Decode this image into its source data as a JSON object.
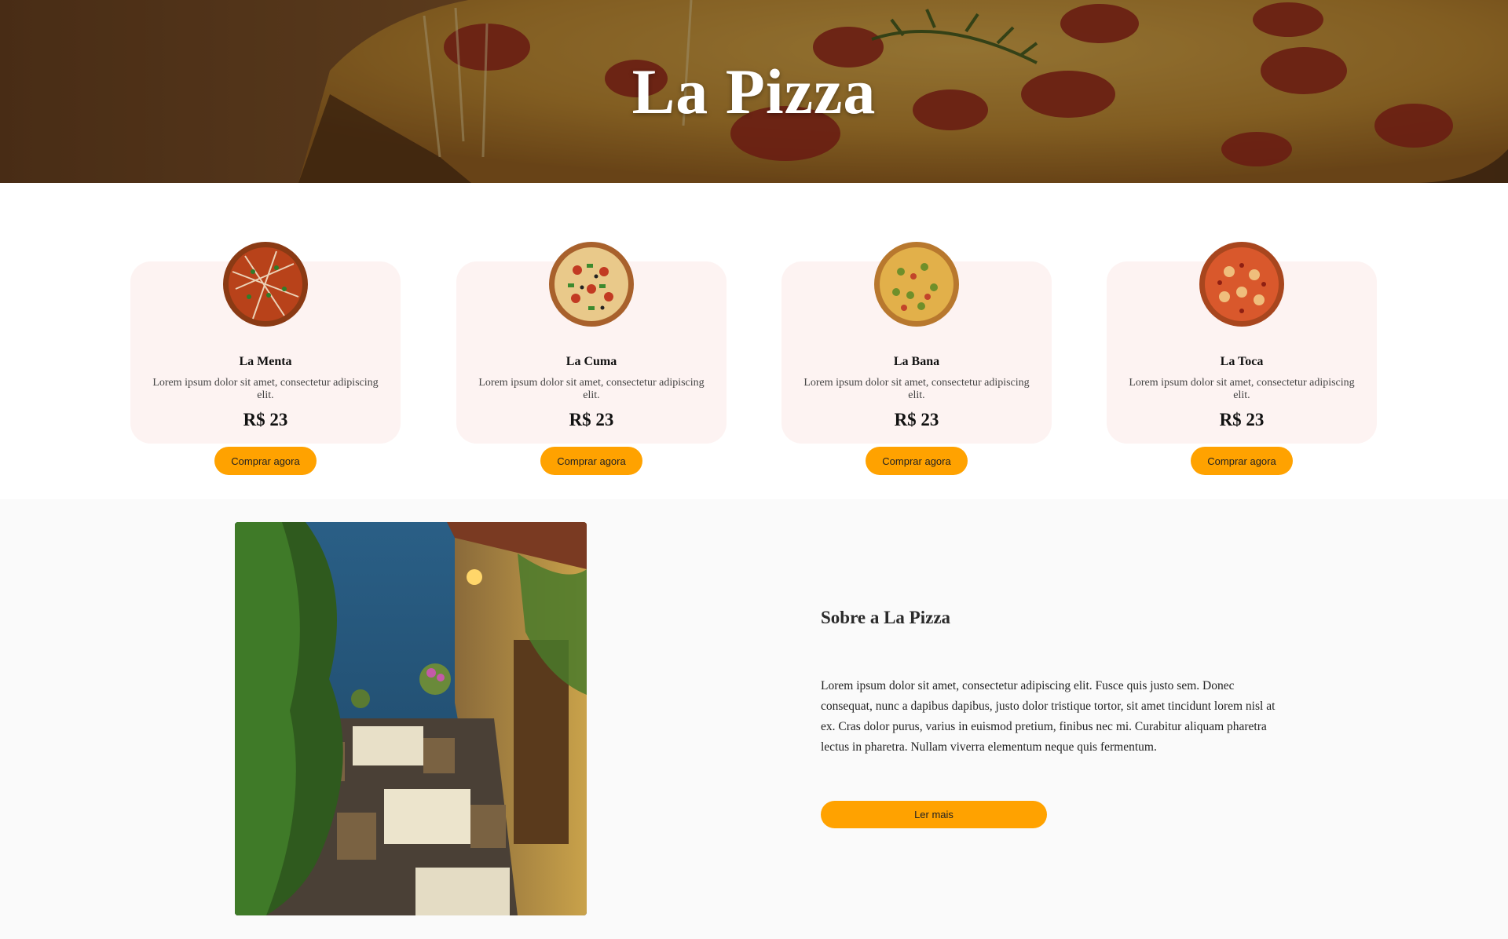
{
  "hero": {
    "title": "La Pizza"
  },
  "products": [
    {
      "name": "La Menta",
      "description": "Lorem ipsum dolor sit amet, consectetur adipiscing elit.",
      "price": "R$ 23",
      "button_label": "Comprar agora"
    },
    {
      "name": "La Cuma",
      "description": "Lorem ipsum dolor sit amet, consectetur adipiscing elit.",
      "price": "R$ 23",
      "button_label": "Comprar agora"
    },
    {
      "name": "La Bana",
      "description": "Lorem ipsum dolor sit amet, consectetur adipiscing elit.",
      "price": "R$ 23",
      "button_label": "Comprar agora"
    },
    {
      "name": "La Toca",
      "description": "Lorem ipsum dolor sit amet, consectetur adipiscing elit.",
      "price": "R$ 23",
      "button_label": "Comprar agora"
    }
  ],
  "about": {
    "title": "Sobre a La Pizza",
    "text": "Lorem ipsum dolor sit amet, consectetur adipiscing elit. Fusce quis justo sem. Donec consequat, nunc a dapibus dapibus, justo dolor tristique tortor, sit amet tincidunt lorem nisl at ex. Cras dolor purus, varius in euismod pretium, finibus nec mi. Curabitur aliquam pharetra lectus in pharetra. Nullam viverra elementum neque quis fermentum.",
    "button_label": "Ler mais"
  },
  "colors": {
    "accent": "#ffa200",
    "card_background": "#fdf3f2",
    "section_background": "#fafafa"
  }
}
